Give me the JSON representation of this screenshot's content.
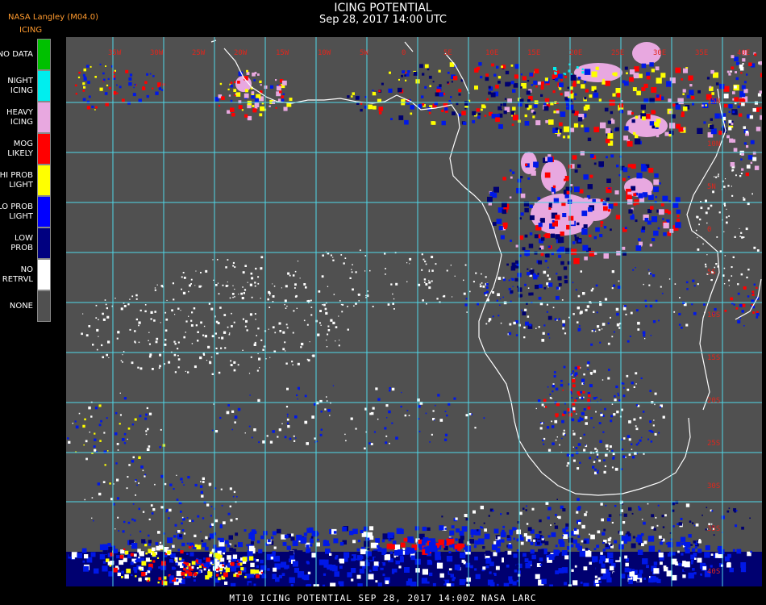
{
  "header": {
    "title": "ICING POTENTIAL",
    "datetime": "Sep 28, 2017 14:00 UTC",
    "producer": "NASA Langley (M04.0)",
    "product": "ICING"
  },
  "legend": [
    {
      "label": "NO DATA",
      "color": "#00c000"
    },
    {
      "label": "NIGHT\nICING",
      "color": "#00eeee"
    },
    {
      "label": "HEAVY\nICING",
      "color": "#e8a8e0"
    },
    {
      "label": "MOG\nLIKELY",
      "color": "#ff0000"
    },
    {
      "label": "HI PROB\nLIGHT",
      "color": "#ffff00"
    },
    {
      "label": "LO PROB\nLIGHT",
      "color": "#0000ff"
    },
    {
      "label": "LOW\nPROB",
      "color": "#000080"
    },
    {
      "label": "NO\nRETRVL",
      "color": "#ffffff"
    },
    {
      "label": "NONE",
      "color": "#505050"
    }
  ],
  "map": {
    "background": "#505050",
    "grid_color": "#4fd8e8",
    "coast_color": "#ffffff",
    "longitude_labels": [
      "35W",
      "30W",
      "25W",
      "20W",
      "15W",
      "10W",
      "5W",
      "0",
      "5E",
      "10E",
      "15E",
      "20E",
      "25E",
      "30E",
      "35E",
      "40E"
    ],
    "latitude_labels": [
      "15N",
      "10N",
      "5N",
      "0",
      "5S",
      "10S",
      "15S",
      "20S",
      "25S",
      "30S",
      "35S",
      "40S"
    ]
  },
  "footer": "MT10   ICING POTENTIAL   SEP 28, 2017 14:00Z   NASA LARC"
}
